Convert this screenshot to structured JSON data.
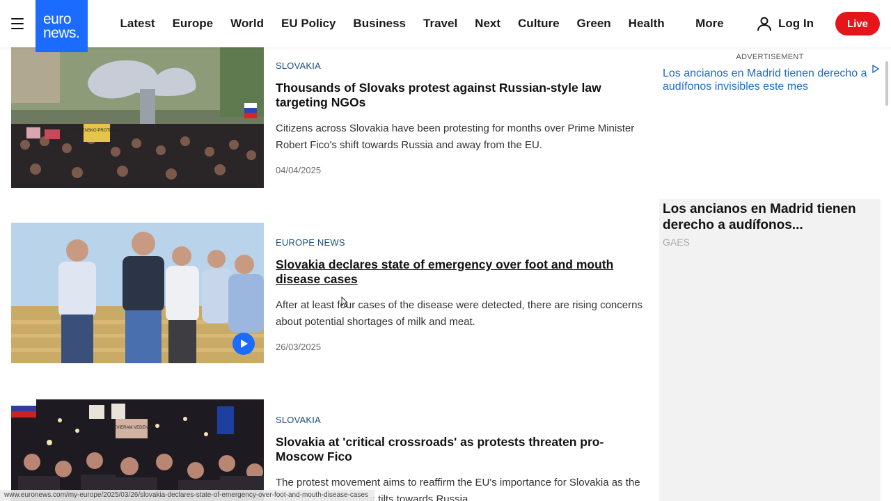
{
  "header": {
    "logo_line1": "euro",
    "logo_line2": "news.",
    "nav": [
      "Latest",
      "Europe",
      "World",
      "EU Policy",
      "Business",
      "Travel",
      "Next",
      "Culture",
      "Green",
      "Health"
    ],
    "more": "More",
    "login": "Log In",
    "live": "Live"
  },
  "articles": [
    {
      "category": "SLOVAKIA",
      "title": "Thousands of Slovaks protest against Russian-style law targeting NGOs",
      "description": "Citizens across Slovakia have been protesting for months over Prime Minister Robert Fico's shift towards Russia and away from the EU.",
      "date": "04/04/2025",
      "sign_text": "SLOVENSKO PROTI MAFII"
    },
    {
      "category": "EUROPE NEWS",
      "title": "Slovakia declares state of emergency over foot and mouth disease cases",
      "description": "After at least four cases of the disease were detected, there are rising concerns about potential shortages of milk and meat.",
      "date": "26/03/2025"
    },
    {
      "category": "SLOVAKIA",
      "title": "Slovakia at 'critical crossroads' as protests threaten pro-Moscow Fico",
      "description": "The protest movement aims to reaffirm the EU's importance for Slovakia as the country's government tilts towards Russia.",
      "sign_text": "NEVIERAM VEDENIU"
    }
  ],
  "sidebar": {
    "ad_label": "ADVERTISEMENT",
    "ad_link": "Los ancianos en Madrid tienen derecho a audífonos invisibles este mes",
    "ad_headline": "Los ancianos en Madrid tienen derecho a audífonos...",
    "ad_brand": "GAES"
  },
  "statusbar": "www.euronews.com/my-europe/2025/03/26/slovakia-declares-state-of-emergency-over-foot-and-mouth-disease-cases",
  "colors": {
    "brand_blue": "#1c6bff",
    "live_red": "#e5161b",
    "category": "#1a4f7c",
    "ad_link": "#1c6bc9"
  }
}
